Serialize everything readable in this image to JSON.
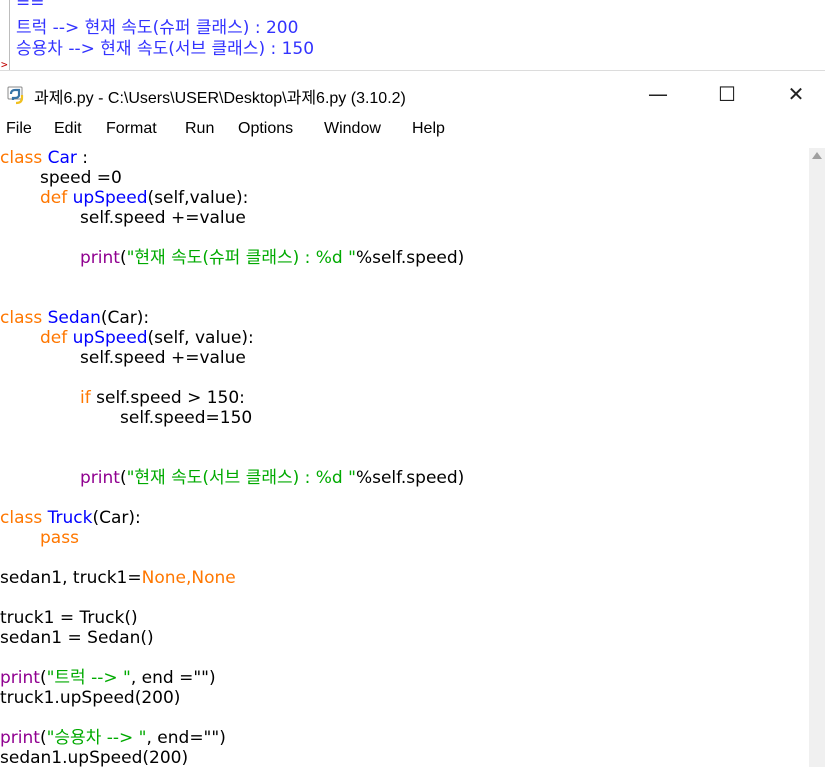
{
  "shell": {
    "lines": [
      "==",
      "트럭 --> 현재 속도(슈퍼 클래스) : 200",
      "승용차 --> 현재 속도(서브 클래스) : 150"
    ],
    "prompt": ">"
  },
  "window": {
    "title": "과제6.py - C:\\Users\\USER\\Desktop\\과제6.py (3.10.2)",
    "icon": "python-icon",
    "minimize": "—",
    "maximize": "☐",
    "close": "✕"
  },
  "menu": [
    "File",
    "Edit",
    "Format",
    "Run",
    "Options",
    "Window",
    "Help"
  ],
  "code": {
    "l1_kw": "class",
    "l1_name": "Car",
    "l1_rest": " :",
    "l2": "speed =0",
    "l3_kw": "def",
    "l3_name": "upSpeed",
    "l3_rest": "(self,value):",
    "l4": "self.speed +=value",
    "l5_bi": "print",
    "l5_open": "(",
    "l5_str": "\"현재 속도(슈퍼 클래스) : %d \"",
    "l5_rest": "%self.speed)",
    "l6_kw": "class",
    "l6_name": "Sedan",
    "l6_rest": "(Car):",
    "l7_kw": "def",
    "l7_name": "upSpeed",
    "l7_rest": "(self, value):",
    "l8": "self.speed +=value",
    "l9_kw": "if",
    "l9_rest": " self.speed > 150:",
    "l10": "self.speed=150",
    "l11_bi": "print",
    "l11_open": "(",
    "l11_str": "\"현재 속도(서브 클래스) : %d \"",
    "l11_rest": "%self.speed)",
    "l12_kw": "class",
    "l12_name": "Truck",
    "l12_rest": "(Car):",
    "l13_kw": "pass",
    "l14_a": "sedan1, truck1=",
    "l14_kw1": "None",
    "l14_comma": ",",
    "l14_kw2": "None",
    "l15": "truck1 = Truck()",
    "l16": "sedan1 = Sedan()",
    "l17_bi": "print",
    "l17_open": "(",
    "l17_str": "\"트럭 --> \"",
    "l17_rest": ", end =\"\")",
    "l18": "truck1.upSpeed(200)",
    "l19_bi": "print",
    "l19_open": "(",
    "l19_str": "\"승용차 --> \"",
    "l19_rest": ", end=\"\")",
    "l20": "sedan1.upSpeed(200)"
  },
  "colors": {
    "keyword": "#ff7700",
    "definition": "#0000ff",
    "builtin": "#900090",
    "string": "#00aa00",
    "shell_output": "#3333ff"
  }
}
